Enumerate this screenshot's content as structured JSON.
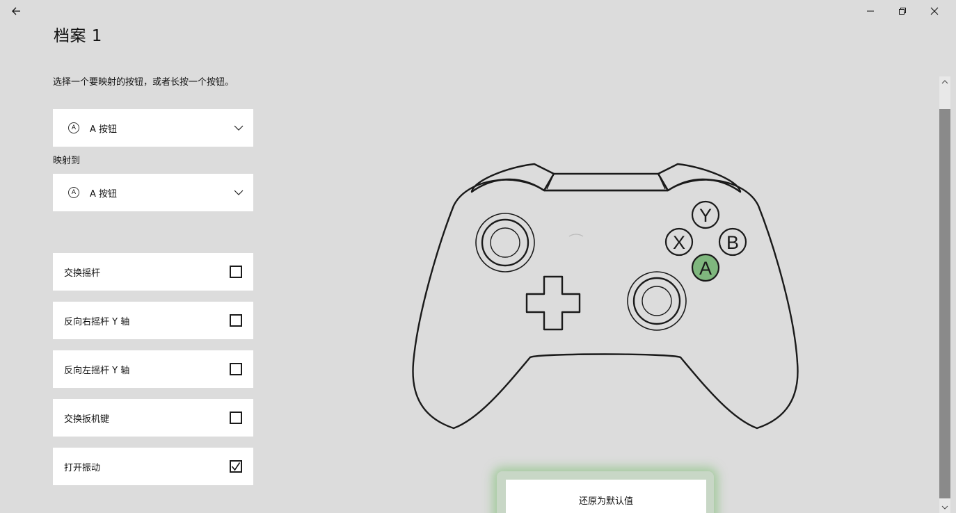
{
  "page": {
    "title": "档案 1",
    "instruction": "选择一个要映射的按钮，或者长按一个按钮。"
  },
  "source_select": {
    "icon_glyph": "A",
    "label": "A 按钮"
  },
  "map_to": {
    "label": "映射到",
    "select": {
      "icon_glyph": "A",
      "label": "A 按钮"
    }
  },
  "toggles": [
    {
      "label": "交换摇杆",
      "checked": false
    },
    {
      "label": "反向右摇杆 Y 轴",
      "checked": false
    },
    {
      "label": "反向左摇杆 Y 轴",
      "checked": false
    },
    {
      "label": "交换扳机键",
      "checked": false
    },
    {
      "label": "打开振动",
      "checked": true
    }
  ],
  "controller": {
    "buttons": {
      "y": "Y",
      "x": "X",
      "b": "B",
      "a": "A"
    },
    "highlighted": "A",
    "highlight_color": "#7fb77e"
  },
  "reset_button": {
    "label": "还原为默认值"
  },
  "icons": [
    "back-arrow-icon",
    "minimize-icon",
    "restore-icon",
    "close-icon",
    "chevron-down-icon",
    "checkmark-icon"
  ]
}
